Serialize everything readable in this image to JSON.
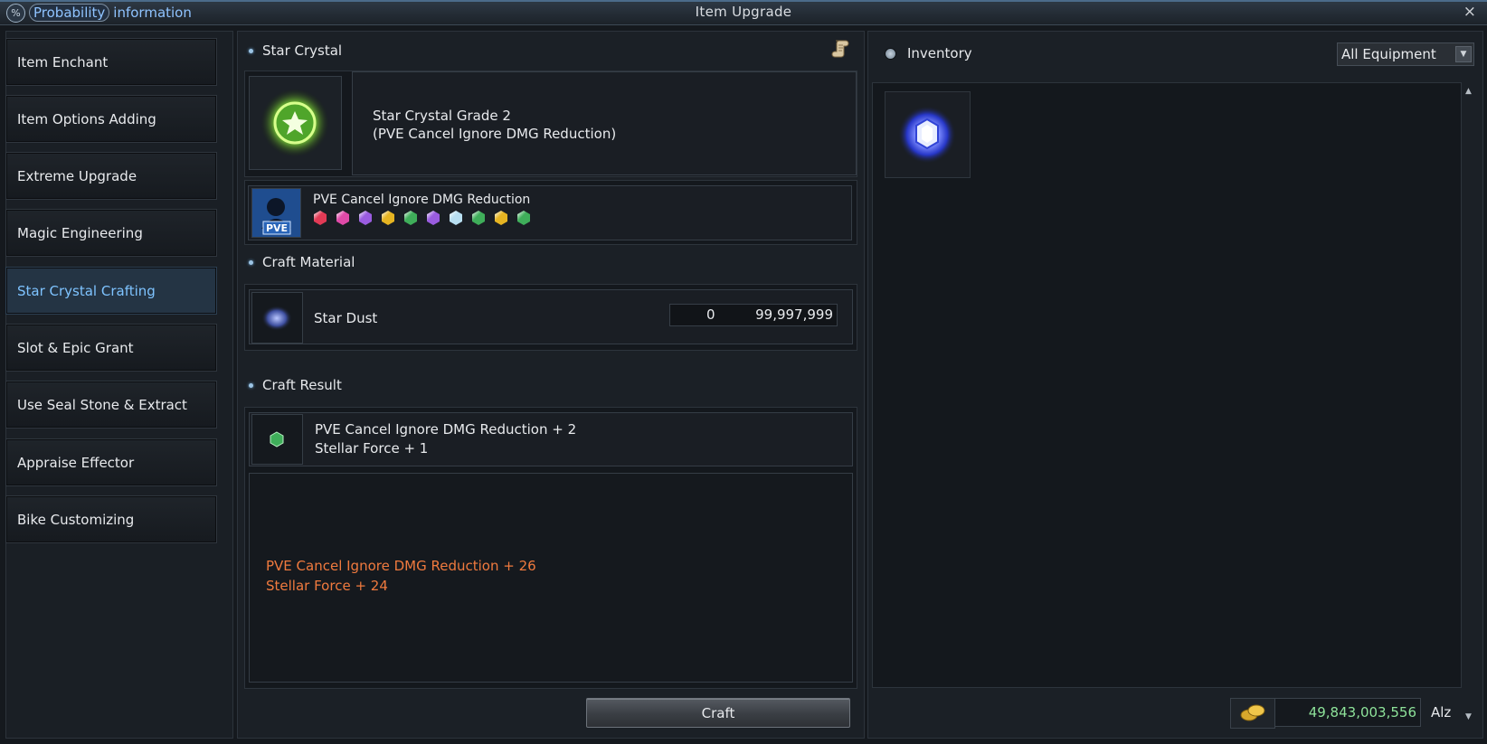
{
  "titlebar": {
    "prob_word1": "Probability",
    "prob_word2": "information",
    "prob_icon": "%",
    "title": "Item Upgrade",
    "close": "×"
  },
  "sidebar": {
    "items": [
      {
        "label": "Item Enchant"
      },
      {
        "label": "Item Options Adding"
      },
      {
        "label": "Extreme Upgrade"
      },
      {
        "label": "Magic Engineering"
      },
      {
        "label": "Star Crystal Crafting"
      },
      {
        "label": "Slot & Epic Grant"
      },
      {
        "label": "Use Seal Stone & Extract"
      },
      {
        "label": "Appraise Effector"
      },
      {
        "label": "Bike Customizing"
      }
    ],
    "active_index": 4
  },
  "star_crystal": {
    "section_label": "Star Crystal",
    "name_line1": "Star Crystal Grade 2",
    "name_line2": "(PVE Cancel Ignore DMG Reduction)",
    "option_name": "PVE Cancel Ignore DMG Reduction",
    "option_badge": "PVE",
    "gems": [
      {
        "color": "#e23a55"
      },
      {
        "color": "#e04aa8"
      },
      {
        "color": "#9a5ce0"
      },
      {
        "color": "#e6b422"
      },
      {
        "color": "#3fae5a"
      },
      {
        "color": "#9a5ce0"
      },
      {
        "color": "#b8dff2"
      },
      {
        "color": "#3fae5a"
      },
      {
        "color": "#e6b422"
      },
      {
        "color": "#3fae5a"
      }
    ]
  },
  "craft_material": {
    "section_label": "Craft Material",
    "name": "Star Dust",
    "have": "0",
    "max": "99,997,999"
  },
  "craft_result": {
    "section_label": "Craft Result",
    "line1": "PVE Cancel Ignore DMG Reduction + 2",
    "line2": "Stellar Force + 1",
    "detail_line1": "PVE Cancel Ignore DMG Reduction + 26",
    "detail_line2": "Stellar Force + 24"
  },
  "craft_button": "Craft",
  "inventory": {
    "label": "Inventory",
    "filter": "All Equipment",
    "alz_amount": "49,843,003,556",
    "alz_unit": "Alz"
  },
  "colors": {
    "active_text": "#7ec3ff",
    "result_orange": "#f07a3e",
    "alz_green": "#8ee39a"
  }
}
